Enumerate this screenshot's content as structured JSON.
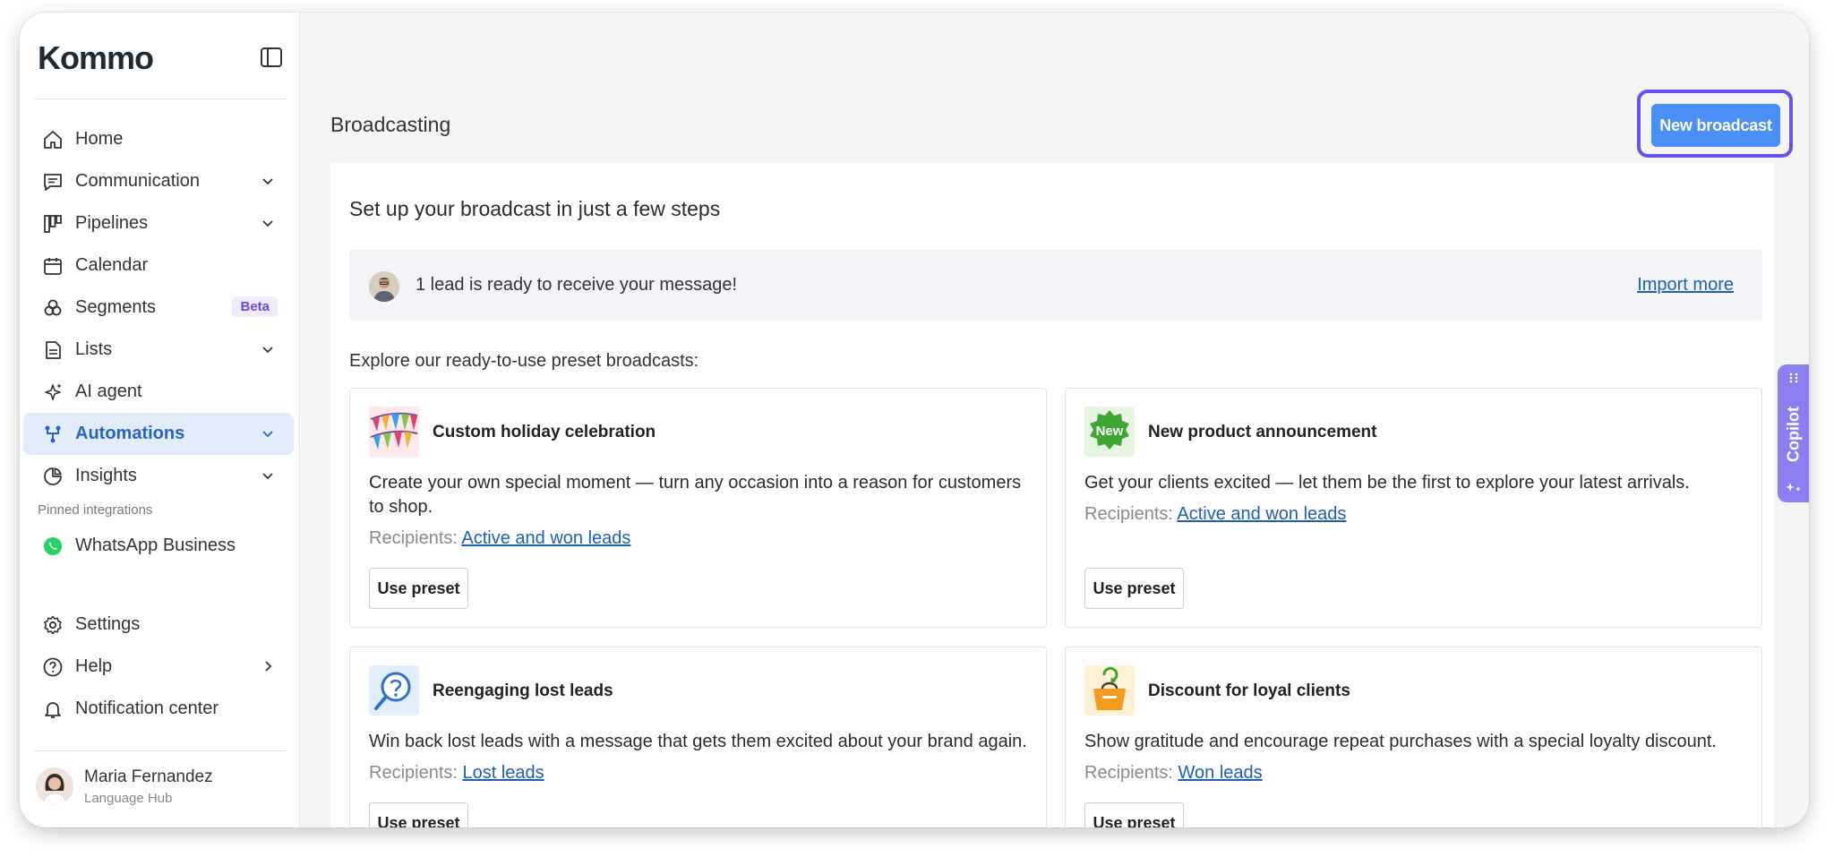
{
  "sidebar": {
    "logo": "Kommo",
    "nav": [
      {
        "label": "Home",
        "icon": "home-icon"
      },
      {
        "label": "Communication",
        "icon": "chat-icon"
      },
      {
        "label": "Pipelines",
        "icon": "pipelines-icon"
      },
      {
        "label": "Calendar",
        "icon": "calendar-icon"
      },
      {
        "label": "Segments",
        "icon": "segments-icon",
        "badge": "Beta"
      },
      {
        "label": "Lists",
        "icon": "list-icon"
      },
      {
        "label": "AI agent",
        "icon": "sparkle-icon"
      },
      {
        "label": "Automations",
        "icon": "automations-icon",
        "active": true
      },
      {
        "label": "Insights",
        "icon": "insights-icon"
      }
    ],
    "pinned_label": "Pinned integrations",
    "pinned": [
      {
        "label": "WhatsApp Business",
        "icon": "whatsapp-icon"
      }
    ],
    "bottom": [
      {
        "label": "Settings",
        "icon": "gear-icon"
      },
      {
        "label": "Help",
        "icon": "help-icon"
      },
      {
        "label": "Notification center",
        "icon": "bell-icon"
      }
    ],
    "profile": {
      "name": "Maria Fernandez",
      "org": "Language Hub"
    }
  },
  "header": {
    "title": "Broadcasting",
    "new_button": "New broadcast"
  },
  "panel": {
    "title": "Set up your broadcast in just a few steps",
    "lead_banner": {
      "text": "1 lead is ready to receive your message!",
      "link": "Import more"
    },
    "explore_label": "Explore our ready-to-use preset broadcasts:",
    "recipients_label": "Recipients:",
    "use_preset": "Use preset",
    "cards": [
      {
        "title": "Custom holiday celebration",
        "desc": "Create your own special moment — turn any occasion into a reason for customers to shop.",
        "recipients": "Active and won leads",
        "icon": "holiday-flags-icon"
      },
      {
        "title": "New product announcement",
        "desc": "Get your clients excited — let them be the first to explore your latest arrivals.",
        "recipients": "Active and won leads",
        "icon": "new-badge-icon"
      },
      {
        "title": "Reengaging lost leads",
        "desc": "Win back lost leads with a message that gets them excited about your brand again.",
        "recipients": "Lost leads",
        "icon": "search-question-icon"
      },
      {
        "title": "Discount for loyal clients",
        "desc": "Show gratitude and encourage repeat purchases with a special loyalty discount.",
        "recipients": "Won leads",
        "icon": "shopping-bag-icon"
      }
    ]
  },
  "copilot": {
    "label": "Copilot"
  },
  "colors": {
    "accent": "#4a90f7",
    "highlight_ring": "#6b4ff0",
    "link": "#1f5fb8",
    "active_bg": "#e3ecfb",
    "copilot": "#8b7ff2"
  }
}
